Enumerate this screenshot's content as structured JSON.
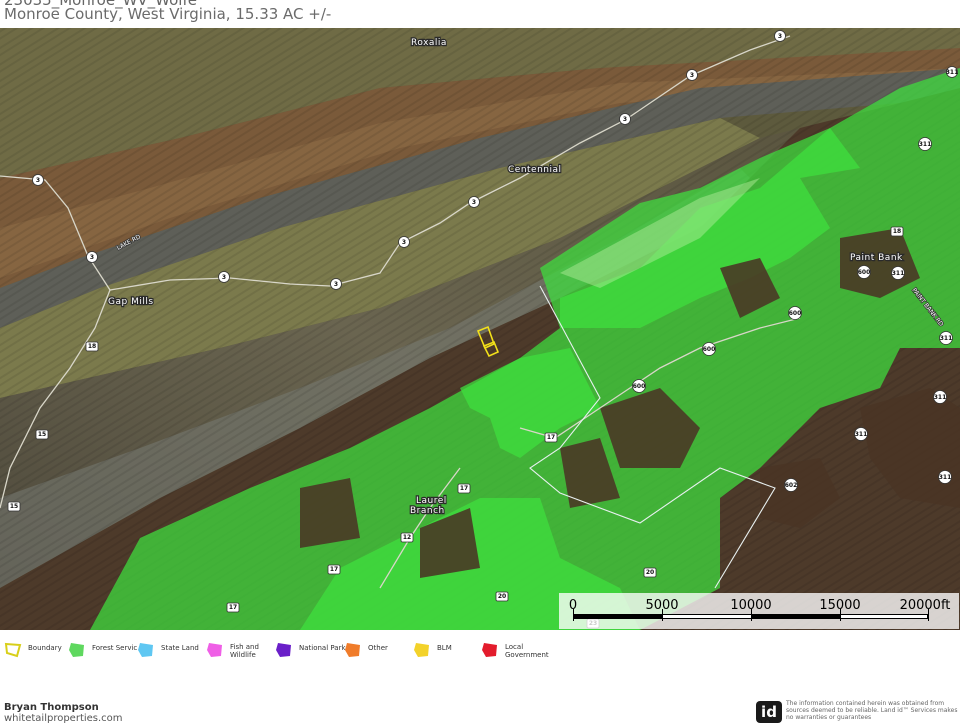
{
  "header": {
    "title": "23035_Monroe_WV_Wolfe",
    "subtitle": "Monroe County, West Virginia, 15.33 AC +/-"
  },
  "map": {
    "place_labels": {
      "roxalia": "Roxalia",
      "centennial": "Centennial",
      "gap_mills": "Gap Mills",
      "paint_bank": "Paint Bank",
      "laurel_branch_1": "Laurel",
      "laurel_branch_2": "Branch"
    },
    "road_labels": {
      "lake_rd": "LAKE RD",
      "paint_bank_rd": "PAINT BANK RD"
    },
    "shields": {
      "r3": "3",
      "r18": "18",
      "r15": "15",
      "r17": "17",
      "r12": "12",
      "r20": "20",
      "r600": "600",
      "r602": "602",
      "r311": "311",
      "r23": "23"
    },
    "colors": {
      "forest_service": "#4ad64a",
      "boundary": "#e6d400"
    }
  },
  "scalebar": {
    "labels": [
      "0",
      "5000",
      "10000",
      "15000",
      "20000ft"
    ]
  },
  "legend": {
    "items": [
      {
        "label": "Boundary",
        "color": "#d8cf1a",
        "icon": "boundary-outline-icon"
      },
      {
        "label": "Forest Servic",
        "color": "#5fd85f",
        "icon": "pentagon-icon"
      },
      {
        "label": "State Land",
        "color": "#5fc7f2",
        "icon": "pentagon-icon"
      },
      {
        "label": "Fish and Wildlife",
        "color": "#ef5fe6",
        "icon": "pentagon-icon"
      },
      {
        "label": "National Park",
        "color": "#6a1fc9",
        "icon": "pentagon-icon"
      },
      {
        "label": "Other",
        "color": "#f07c2a",
        "icon": "pentagon-icon"
      },
      {
        "label": "BLM",
        "color": "#f3d22a",
        "icon": "pentagon-icon"
      },
      {
        "label": "Local Government",
        "color": "#e31c2c",
        "icon": "pentagon-icon"
      }
    ]
  },
  "footer": {
    "name": "Bryan Thompson",
    "website": "whitetailproperties.com",
    "logo_text": "id",
    "disclaimer": "The information contained herein was obtained from sources deemed to be reliable. Land id™ Services makes no warranties or guarantees"
  }
}
